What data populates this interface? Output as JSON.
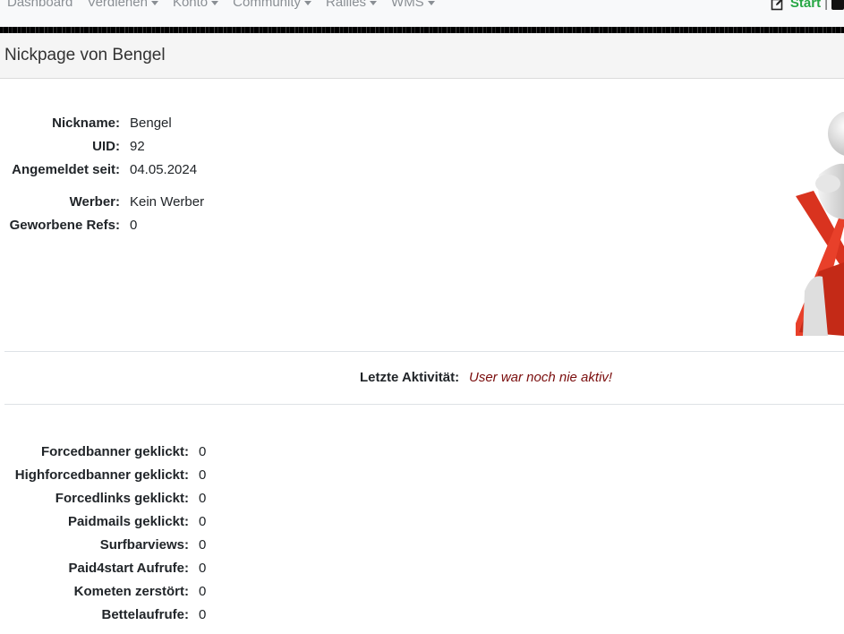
{
  "nav": {
    "items": [
      {
        "label": "Dashboard",
        "dropdown": false
      },
      {
        "label": "Verdienen",
        "dropdown": true
      },
      {
        "label": "Konto",
        "dropdown": true
      },
      {
        "label": "Community",
        "dropdown": true
      },
      {
        "label": "Rallies",
        "dropdown": true
      },
      {
        "label": "WMS",
        "dropdown": true
      }
    ],
    "start_label": "Start",
    "separator": "|",
    "start_icon": "edit-icon",
    "start_color": "#28a745"
  },
  "header": {
    "title": "Nickpage von Bengel"
  },
  "profile": {
    "fields": [
      {
        "label": "Nickname:",
        "value": "Bengel"
      },
      {
        "label": "UID:",
        "value": "92"
      },
      {
        "label": "Angemeldet seit:",
        "value": "04.05.2024"
      },
      {
        "label": "Werber:",
        "value": "Kein Werber"
      },
      {
        "label": "Geworbene Refs:",
        "value": "0"
      }
    ]
  },
  "activity": {
    "label": "Letzte Aktivität:",
    "value": "User war noch nie aktiv!",
    "value_color": "#7a0d0d"
  },
  "stats": [
    {
      "label": "Forcedbanner geklickt:",
      "value": "0"
    },
    {
      "label": "Highforcedbanner geklickt:",
      "value": "0"
    },
    {
      "label": "Forcedlinks geklickt:",
      "value": "0"
    },
    {
      "label": "Paidmails geklickt:",
      "value": "0"
    },
    {
      "label": "Surfbarviews:",
      "value": "0"
    },
    {
      "label": "Paid4start Aufrufe:",
      "value": "0"
    },
    {
      "label": "Kometen zerstört:",
      "value": "0"
    },
    {
      "label": "Bettelaufrufe:",
      "value": "0"
    }
  ]
}
